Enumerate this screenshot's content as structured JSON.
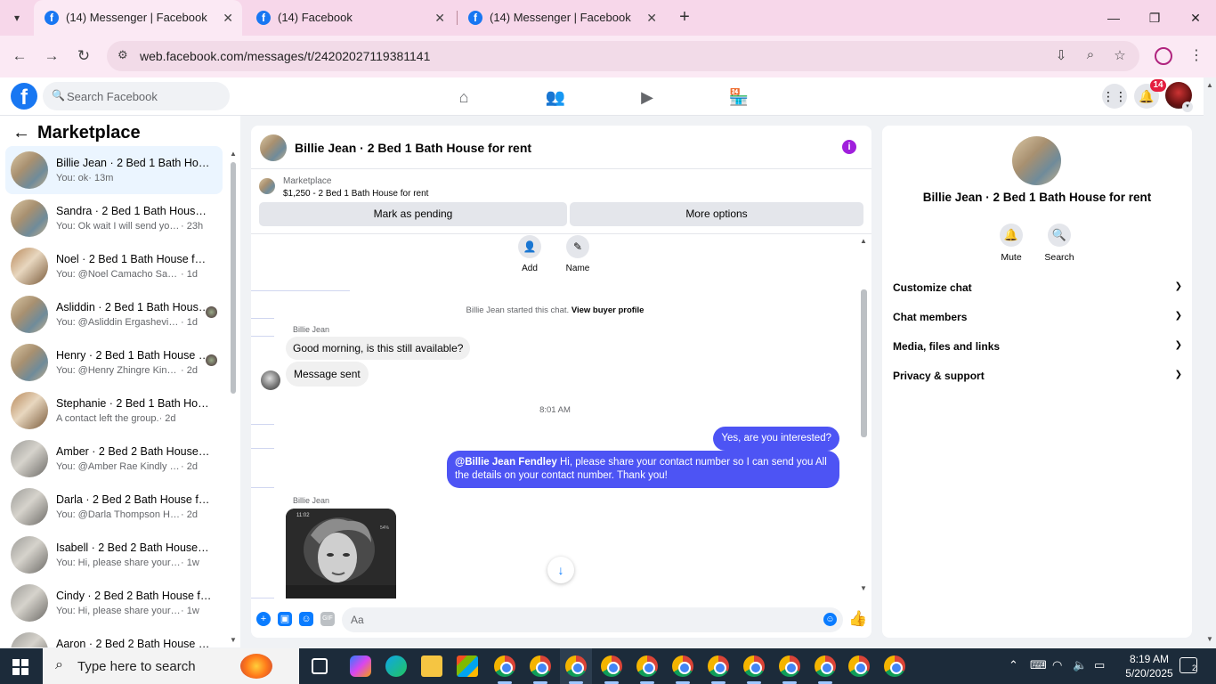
{
  "browser": {
    "tabs": [
      {
        "label": "(14) Messenger | Facebook",
        "active": true
      },
      {
        "label": "(14) Facebook",
        "active": false
      },
      {
        "label": "(14) Messenger | Facebook",
        "active": false
      }
    ],
    "url": "web.facebook.com/messages/t/24202027119381141"
  },
  "fb": {
    "search_placeholder": "Search Facebook",
    "notification_count": "14"
  },
  "sidebar": {
    "title": "Marketplace",
    "conversations": [
      {
        "name": "Billie Jean · 2 Bed 1 Bath House for rent",
        "preview": "You: ok",
        "time": "· 13m",
        "selected": true,
        "thumb": "a",
        "seen": false
      },
      {
        "name": "Sandra · 2 Bed 1 Bath House for rent",
        "preview": "You: Ok wait I will send you All details",
        "time": "· 23h",
        "selected": false,
        "thumb": "a",
        "seen": false
      },
      {
        "name": "Noel · 2 Bed 1 Bath House for rent",
        "preview": "You: @Noel Camacho Sanchez Kindly share",
        "time": "· 1d",
        "selected": false,
        "thumb": "b",
        "seen": false
      },
      {
        "name": "Asliddin · 2 Bed 1 Bath House for rent",
        "preview": "You: @Asliddin Ergashevich Kindly share",
        "time": "· 1d",
        "selected": false,
        "thumb": "a",
        "seen": true
      },
      {
        "name": "Henry · 2 Bed 1 Bath House for rent",
        "preview": "You: @Henry Zhingre Kindly share",
        "time": "· 2d",
        "selected": false,
        "thumb": "a",
        "seen": true
      },
      {
        "name": "Stephanie · 2 Bed 1 Bath House for rent",
        "preview": "A contact left the group.",
        "time": "· 2d",
        "selected": false,
        "thumb": "b",
        "seen": false
      },
      {
        "name": "Amber · 2 Bed 2 Bath House for rent",
        "preview": "You: @Amber Rae Kindly share your contact",
        "time": "· 2d",
        "selected": false,
        "thumb": "c",
        "seen": false
      },
      {
        "name": "Darla · 2 Bed 2 Bath House for rent",
        "preview": "You: @Darla Thompson Hi, please share",
        "time": "· 2d",
        "selected": false,
        "thumb": "c",
        "seen": false
      },
      {
        "name": "Isabell · 2 Bed 2 Bath House for rent",
        "preview": "You: Hi, please share your contact number",
        "time": "· 1w",
        "selected": false,
        "thumb": "c",
        "seen": false
      },
      {
        "name": "Cindy · 2 Bed 2 Bath House for rent",
        "preview": "You: Hi, please share your contact number",
        "time": "· 1w",
        "selected": false,
        "thumb": "c",
        "seen": false
      },
      {
        "name": "Aaron · 2 Bed 2 Bath House for rent",
        "preview": "",
        "time": "",
        "selected": false,
        "thumb": "c",
        "seen": false
      }
    ]
  },
  "chat": {
    "title": "Billie Jean · 2 Bed 1 Bath House for rent",
    "marketplace_label": "Marketplace",
    "listing": "$1,250 - 2 Bed 1 Bath House for rent",
    "mark_pending": "Mark as pending",
    "more_options": "More options",
    "actions": {
      "add": "Add",
      "name": "Name"
    },
    "started_prefix": "Billie Jean started this chat.",
    "started_link": "View buyer profile",
    "sender1": "Billie Jean",
    "msg1": "Good morning, is this still available?",
    "msg2": "Message sent",
    "time_sep": "8:01 AM",
    "out1": "Yes, are you interested?",
    "out2_mention": "@Billie Jean Fendley",
    "out2_text": " Hi, please share your contact number so I can send you All the details on your contact number. Thank you!",
    "sender2": "Billie Jean",
    "photo_time": "11:02",
    "photo_battery": "54%",
    "composer_placeholder": "Aa"
  },
  "right_panel": {
    "title": "Billie Jean · 2 Bed 1 Bath House for rent",
    "mute": "Mute",
    "search": "Search",
    "sections": [
      "Customize chat",
      "Chat members",
      "Media, files and links",
      "Privacy & support"
    ]
  },
  "taskbar": {
    "search_text": "Type here to search",
    "time": "8:19 AM",
    "date": "5/20/2025",
    "notif_count": "2"
  },
  "colors": {
    "accent": "#0a7cff",
    "outgoing_bubble": "#4d54f4",
    "info_icon": "#a01fdc",
    "browser_tabbar": "#f7d7ea",
    "fb_blue": "#1877f2"
  }
}
